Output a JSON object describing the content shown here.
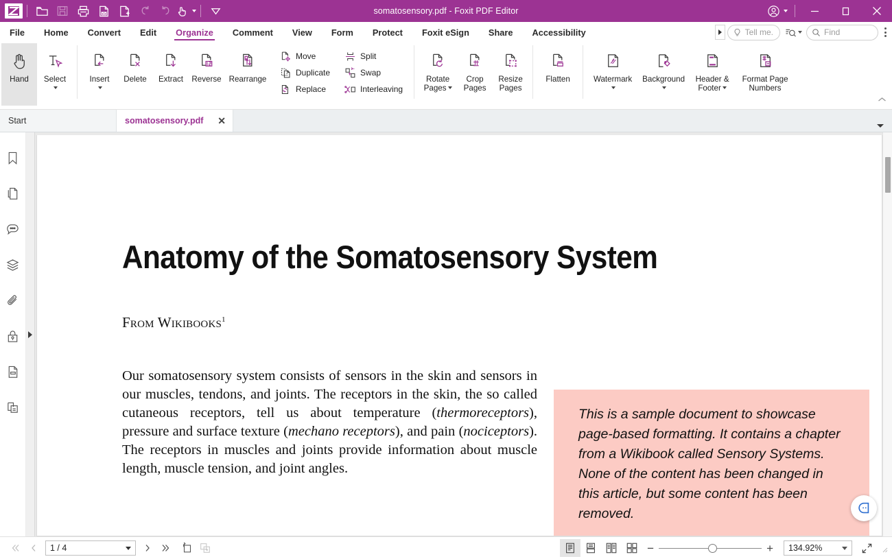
{
  "window": {
    "title": "somatosensory.pdf - Foxit PDF Editor",
    "accent_color": "#9c3393",
    "quick_access": [
      {
        "name": "open-file",
        "label": "Open"
      },
      {
        "name": "save-file",
        "label": "Save"
      },
      {
        "name": "print-file",
        "label": "Print"
      },
      {
        "name": "email-file",
        "label": "Email"
      },
      {
        "name": "create-pdf",
        "label": "Create PDF"
      },
      {
        "name": "undo",
        "label": "Undo"
      },
      {
        "name": "redo",
        "label": "Redo"
      },
      {
        "name": "touch-mode",
        "label": "Touch Mode"
      },
      {
        "name": "customize-toolbar",
        "label": "Customize Quick Access Toolbar"
      }
    ],
    "controls": {
      "account": "Account",
      "minimize": "Minimize",
      "restore": "Restore",
      "close": "Close"
    }
  },
  "menubar": {
    "items": [
      {
        "label": "File",
        "active": false
      },
      {
        "label": "Home",
        "active": false
      },
      {
        "label": "Convert",
        "active": false
      },
      {
        "label": "Edit",
        "active": false
      },
      {
        "label": "Organize",
        "active": true
      },
      {
        "label": "Comment",
        "active": false
      },
      {
        "label": "View",
        "active": false
      },
      {
        "label": "Form",
        "active": false
      },
      {
        "label": "Protect",
        "active": false
      },
      {
        "label": "Foxit eSign",
        "active": false
      },
      {
        "label": "Share",
        "active": false
      },
      {
        "label": "Accessibility",
        "active": false
      }
    ],
    "tell_me_placeholder": "Tell me.",
    "find_placeholder": "Find"
  },
  "ribbon": {
    "tools": [
      {
        "label": "Hand",
        "icon": "hand-icon",
        "selected": true,
        "dropdown": false
      },
      {
        "label": "Select",
        "icon": "select-text-icon",
        "selected": false,
        "dropdown": true
      }
    ],
    "pages": [
      {
        "label": "Insert",
        "icon": "insert-page-icon",
        "dropdown": true
      },
      {
        "label": "Delete",
        "icon": "delete-page-icon",
        "dropdown": false
      },
      {
        "label": "Extract",
        "icon": "extract-page-icon",
        "dropdown": false
      },
      {
        "label": "Reverse",
        "icon": "reverse-page-icon",
        "dropdown": false
      },
      {
        "label": "Rearrange",
        "icon": "rearrange-page-icon",
        "dropdown": false
      }
    ],
    "small_col_1": [
      {
        "label": "Move",
        "icon": "move-page-icon"
      },
      {
        "label": "Duplicate",
        "icon": "duplicate-page-icon"
      },
      {
        "label": "Replace",
        "icon": "replace-page-icon"
      }
    ],
    "small_col_2": [
      {
        "label": "Split",
        "icon": "split-page-icon"
      },
      {
        "label": "Swap",
        "icon": "swap-page-icon"
      },
      {
        "label": "Interleaving",
        "icon": "interleaving-icon"
      }
    ],
    "transform": [
      {
        "line1": "Rotate",
        "line2": "Pages",
        "icon": "rotate-pages-icon",
        "dropdown": true
      },
      {
        "line1": "Crop",
        "line2": "Pages",
        "icon": "crop-pages-icon",
        "dropdown": false
      },
      {
        "line1": "Resize",
        "line2": "Pages",
        "icon": "resize-pages-icon",
        "dropdown": false
      }
    ],
    "flatten": {
      "label": "Flatten",
      "icon": "flatten-icon"
    },
    "marks": [
      {
        "line1": "Watermark",
        "line2": "",
        "icon": "watermark-icon",
        "dropdown": true
      },
      {
        "line1": "Background",
        "line2": "",
        "icon": "background-icon",
        "dropdown": true
      },
      {
        "line1": "Header &",
        "line2": "Footer",
        "icon": "header-footer-icon",
        "dropdown": true
      },
      {
        "line1": "Format Page",
        "line2": "Numbers",
        "icon": "format-page-numbers-icon",
        "dropdown": false
      }
    ]
  },
  "tabbar": {
    "tabs": [
      {
        "label": "Start",
        "active": false,
        "closable": false
      },
      {
        "label": "somatosensory.pdf",
        "active": true,
        "closable": true,
        "close_glyph": "✕"
      }
    ]
  },
  "navpane": {
    "items": [
      {
        "name": "bookmarks-icon",
        "label": "Bookmarks"
      },
      {
        "name": "page-thumbnails-icon",
        "label": "Page Thumbnails"
      },
      {
        "name": "comments-icon",
        "label": "Comments"
      },
      {
        "name": "layers-icon",
        "label": "Layers"
      },
      {
        "name": "attachments-icon",
        "label": "Attachments"
      },
      {
        "name": "security-icon",
        "label": "Security Settings"
      },
      {
        "name": "fields-icon",
        "label": "Fields"
      },
      {
        "name": "stamps-icon",
        "label": "Stamps"
      }
    ]
  },
  "document": {
    "title": "Anatomy of the Somatosensory System",
    "byline_text": "From Wikibooks",
    "byline_footnote": "1",
    "body_paragraph": "Our somatosensory system consists of sensors in the skin and sensors in our muscles, tendons, and joints. The receptors in the skin, the so called cutaneous receptors, tell us about temperature (thermoreceptors), pressure and surface texture (mechano receptors), and pain (nociceptors). The receptors in muscles and joints provide information about muscle length, muscle tension, and joint angles.",
    "callout_text": "This is a sample document to showcase page-based formatting. It contains a chapter from a Wikibook called Sensory Systems. None of the content has been changed in this article, but some content has been removed.",
    "callout_bg": "#fccbc4"
  },
  "assistant": {
    "name": "ai-assistant-button",
    "color": "#2f6fd0"
  },
  "statusbar": {
    "first_page": "«",
    "prev_page": "‹",
    "page_value": "1 / 4",
    "next_page": "›",
    "last_page": "»",
    "view_rotate_label": "Rotate View",
    "view_reflow_label": "Reflow",
    "page_views": [
      {
        "name": "single-page-view",
        "label": "Single Page",
        "selected": true
      },
      {
        "name": "continuous-view",
        "label": "Continuous",
        "selected": false
      },
      {
        "name": "facing-view",
        "label": "Facing",
        "selected": false
      },
      {
        "name": "continuous-facing-view",
        "label": "Continuous Facing",
        "selected": false
      }
    ],
    "zoom_out": "−",
    "zoom_in": "+",
    "zoom_value": "134.92%",
    "fullscreen_label": "Full Screen"
  }
}
